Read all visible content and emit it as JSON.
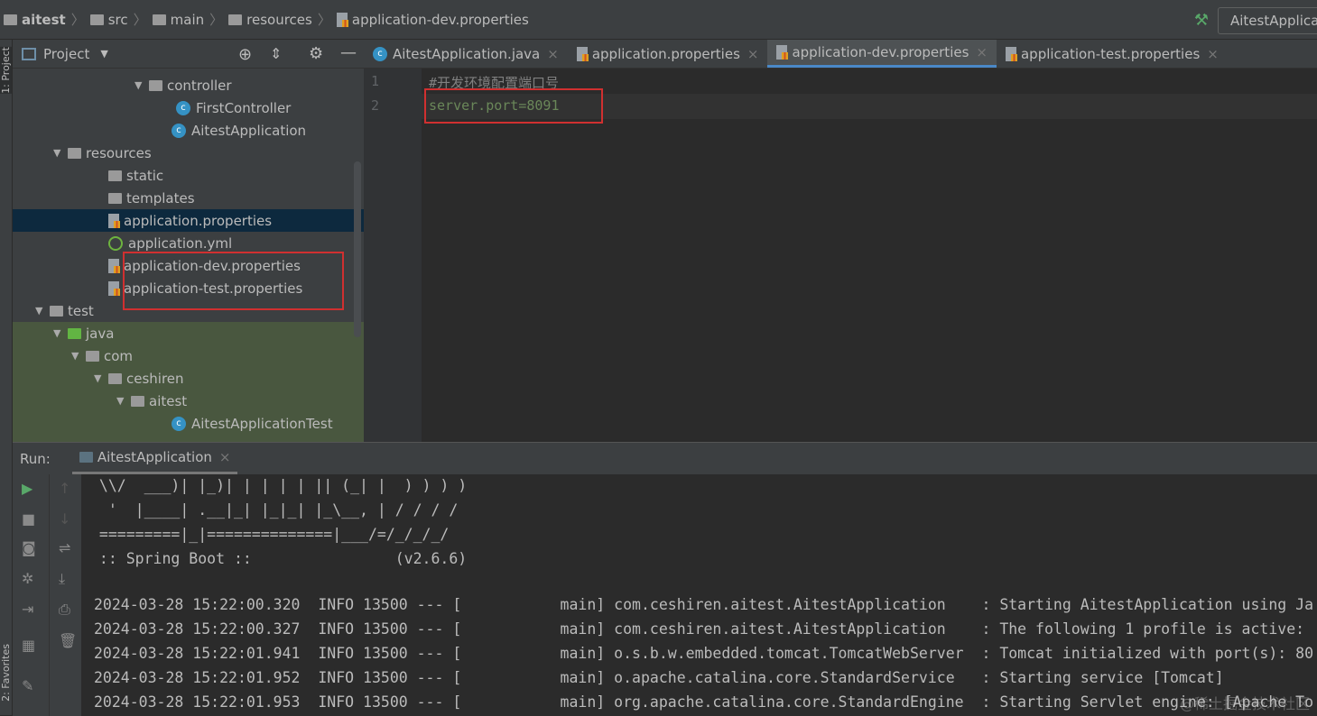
{
  "breadcrumb": [
    "aitest",
    "src",
    "main",
    "resources",
    "application-dev.properties"
  ],
  "run_config": "AitestApplication",
  "left_strip": {
    "project": "1: Project",
    "favorites": "2: Favorites"
  },
  "project_panel": {
    "title": "Project",
    "tree": [
      {
        "label": "controller",
        "type": "package",
        "expanded": true
      },
      {
        "label": "FirstController",
        "type": "class"
      },
      {
        "label": "AitestApplication",
        "type": "spring-class"
      },
      {
        "label": "resources",
        "type": "resources-folder",
        "expanded": true
      },
      {
        "label": "static",
        "type": "folder"
      },
      {
        "label": "templates",
        "type": "folder"
      },
      {
        "label": "application.properties",
        "type": "properties",
        "selected": true
      },
      {
        "label": "application.yml",
        "type": "spring-yml"
      },
      {
        "label": "application-dev.properties",
        "type": "properties",
        "highlighted": true
      },
      {
        "label": "application-test.properties",
        "type": "properties",
        "highlighted": true
      },
      {
        "label": "test",
        "type": "folder",
        "expanded": true
      },
      {
        "label": "java",
        "type": "test-source",
        "expanded": true
      },
      {
        "label": "com",
        "type": "package",
        "expanded": true
      },
      {
        "label": "ceshiren",
        "type": "package",
        "expanded": true
      },
      {
        "label": "aitest",
        "type": "package",
        "expanded": true
      },
      {
        "label": "AitestApplicationTest",
        "type": "spring-class"
      }
    ]
  },
  "editor": {
    "tabs": [
      {
        "label": "AitestApplication.java",
        "active": false
      },
      {
        "label": "application.properties",
        "active": false
      },
      {
        "label": "application-dev.properties",
        "active": true
      },
      {
        "label": "application-test.properties",
        "active": false
      }
    ],
    "lines": [
      {
        "num": "1",
        "text": "#开发环境配置端口号"
      },
      {
        "num": "2",
        "text": "server.port=8091"
      }
    ]
  },
  "run_panel": {
    "label": "Run:",
    "tab": "AitestApplication",
    "banner": [
      " \\\\/  ___)| |_)| | | | | || (_| |  ) ) ) )",
      "  '  |____| .__|_| |_|_| |_\\__, | / / / /",
      " =========|_|==============|___/=/_/_/_/",
      " :: Spring Boot ::                (v2.6.6)"
    ],
    "logs": [
      "2024-03-28 15:22:00.320  INFO 13500 --- [           main] com.ceshiren.aitest.AitestApplication    : Starting AitestApplication using Ja",
      "2024-03-28 15:22:00.327  INFO 13500 --- [           main] com.ceshiren.aitest.AitestApplication    : The following 1 profile is active: ",
      "2024-03-28 15:22:01.941  INFO 13500 --- [           main] o.s.b.w.embedded.tomcat.TomcatWebServer  : Tomcat initialized with port(s): 80",
      "2024-03-28 15:22:01.952  INFO 13500 --- [           main] o.apache.catalina.core.StandardService   : Starting service [Tomcat]",
      "2024-03-28 15:22:01.953  INFO 13500 --- [           main] org.apache.catalina.core.StandardEngine  : Starting Servlet engine: [Apache To"
    ]
  },
  "watermark": "@稀土掘金技术社区",
  "colors": {
    "accent": "#4a88c7",
    "highlight_box": "#d03030",
    "selected_row": "#0d293e",
    "test_bg": "#49573f",
    "run_green": "#59a869"
  }
}
